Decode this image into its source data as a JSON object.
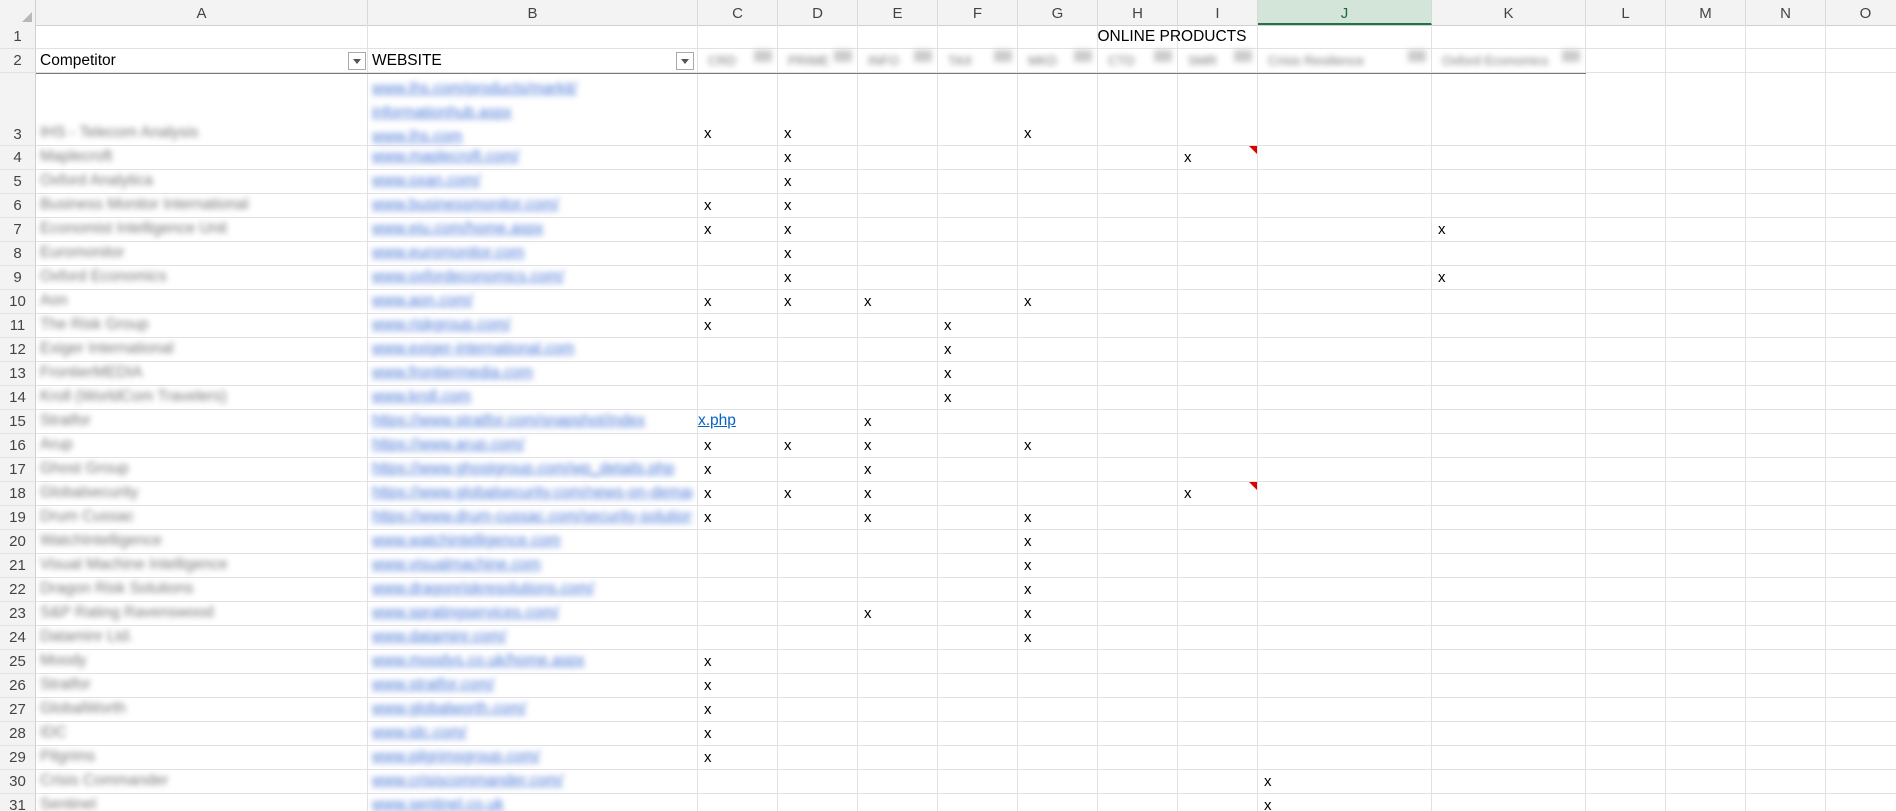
{
  "columns": [
    "A",
    "B",
    "C",
    "D",
    "E",
    "F",
    "G",
    "H",
    "I",
    "J",
    "K",
    "L",
    "M",
    "N",
    "O"
  ],
  "selected_column": "J",
  "row_numbers": [
    "1",
    "2",
    "3",
    "4",
    "5",
    "6",
    "7",
    "8",
    "9",
    "10",
    "11",
    "12",
    "13",
    "14",
    "15",
    "16",
    "17",
    "18",
    "19",
    "20",
    "21",
    "22",
    "23",
    "24",
    "25",
    "26",
    "27",
    "28",
    "29",
    "30",
    "31"
  ],
  "header": {
    "group_title": "ONLINE PRODUCTS",
    "competitor_label": "Competitor",
    "website_label": "WEBSITE"
  },
  "row3_links": [
    "www.ihs.com/products/markit/",
    "informationhub.aspx",
    "www.ihs.com"
  ],
  "competitors": [
    "IHS - Telecom Analysis",
    "Maplecroft",
    "Oxford Analytica",
    "Business Monitor International",
    "Economist Intelligence Unit",
    "Euromonitor",
    "Oxford Economics",
    "Aon",
    "The Risk Group",
    "Exiger International",
    "FrontierMEDIA",
    "Kroll (WorldCom Travelers)",
    "Stratfor",
    "Arup",
    "Ghost Group",
    "Globalsecurity",
    "Drum Cussac",
    "WatchIntelligence",
    "Visual Machine Intelligence",
    "Dragon Risk Solutions",
    "S&P Rating Ravenswood",
    "Dataminr Ltd.",
    "Moody",
    "Stratfor",
    "GlobalWorth",
    "IDC",
    "Pilgrims",
    "Crisis Commander",
    "Sentinel"
  ],
  "websites": [
    "www.ihs.com",
    "www.maplecroft.com/",
    "www.oxan.com/",
    "www.businessmonitor.com/",
    "www.eiu.com/home.aspx",
    "www.euromonitor.com",
    "www.oxfordeconomics.com/",
    "www.aon.com/",
    "www.riskgroup.com/",
    "www.exiger-international.com",
    "www.frontiermedia.com",
    "www.kroll.com",
    "https://www.stratfor.com/snapshot/index",
    "https://www.arup.com/",
    "https://www.ghostgroup.com/wp_details.php",
    "https://www.globalsecurity.com/news-on-demand",
    "https://www.drum-cussac.com/security-solutions",
    "www.watchintelligence.com",
    "www.visualmachine.com",
    "www.dragonriskresolutions.com/",
    "www.spratingservices.com/",
    "www.dataminr.com/",
    "www.moodys.co.uk/home.aspx",
    "www.stratfor.com/",
    "www.globalworth.com/",
    "www.idc.com/",
    "www.pilgrimsgroup.com/",
    "www.crisiscommander.com/",
    "www.sentinel.co.uk"
  ],
  "website_row15_suffix": "x.php",
  "product_header_placeholders": [
    "CRD",
    "PRIME",
    "INFO",
    "TAX",
    "MKD",
    "CTD",
    "SMR",
    "Crisis Resilience",
    "Oxford Economics"
  ],
  "marks": [
    {
      "row": 3,
      "cols": [
        "C",
        "D",
        "G"
      ]
    },
    {
      "row": 4,
      "cols": [
        "D",
        "I"
      ]
    },
    {
      "row": 5,
      "cols": [
        "D"
      ]
    },
    {
      "row": 6,
      "cols": [
        "C",
        "D"
      ]
    },
    {
      "row": 7,
      "cols": [
        "C",
        "D",
        "K"
      ]
    },
    {
      "row": 8,
      "cols": [
        "D"
      ]
    },
    {
      "row": 9,
      "cols": [
        "D",
        "K"
      ]
    },
    {
      "row": 10,
      "cols": [
        "C",
        "D",
        "E",
        "G"
      ]
    },
    {
      "row": 11,
      "cols": [
        "C",
        "F"
      ]
    },
    {
      "row": 12,
      "cols": [
        "F"
      ]
    },
    {
      "row": 13,
      "cols": [
        "F"
      ]
    },
    {
      "row": 14,
      "cols": [
        "F"
      ]
    },
    {
      "row": 15,
      "cols": [
        "E"
      ]
    },
    {
      "row": 16,
      "cols": [
        "C",
        "D",
        "E",
        "G"
      ]
    },
    {
      "row": 17,
      "cols": [
        "C",
        "E"
      ]
    },
    {
      "row": 18,
      "cols": [
        "C",
        "D",
        "E",
        "I"
      ]
    },
    {
      "row": 19,
      "cols": [
        "C",
        "E",
        "G"
      ]
    },
    {
      "row": 20,
      "cols": [
        "G"
      ]
    },
    {
      "row": 21,
      "cols": [
        "G"
      ]
    },
    {
      "row": 22,
      "cols": [
        "G"
      ]
    },
    {
      "row": 23,
      "cols": [
        "E",
        "G"
      ]
    },
    {
      "row": 24,
      "cols": [
        "G"
      ]
    },
    {
      "row": 25,
      "cols": [
        "C"
      ]
    },
    {
      "row": 26,
      "cols": [
        "C"
      ]
    },
    {
      "row": 27,
      "cols": [
        "C"
      ]
    },
    {
      "row": 28,
      "cols": [
        "C"
      ]
    },
    {
      "row": 29,
      "cols": [
        "C"
      ]
    },
    {
      "row": 30,
      "cols": [
        "J"
      ]
    },
    {
      "row": 31,
      "cols": [
        "J"
      ]
    }
  ],
  "mark_symbol": "x",
  "comment_rows": [
    4,
    18
  ],
  "colors": {
    "link": "#0563c1",
    "selected_header": "#217346",
    "comment": "#e00000"
  }
}
